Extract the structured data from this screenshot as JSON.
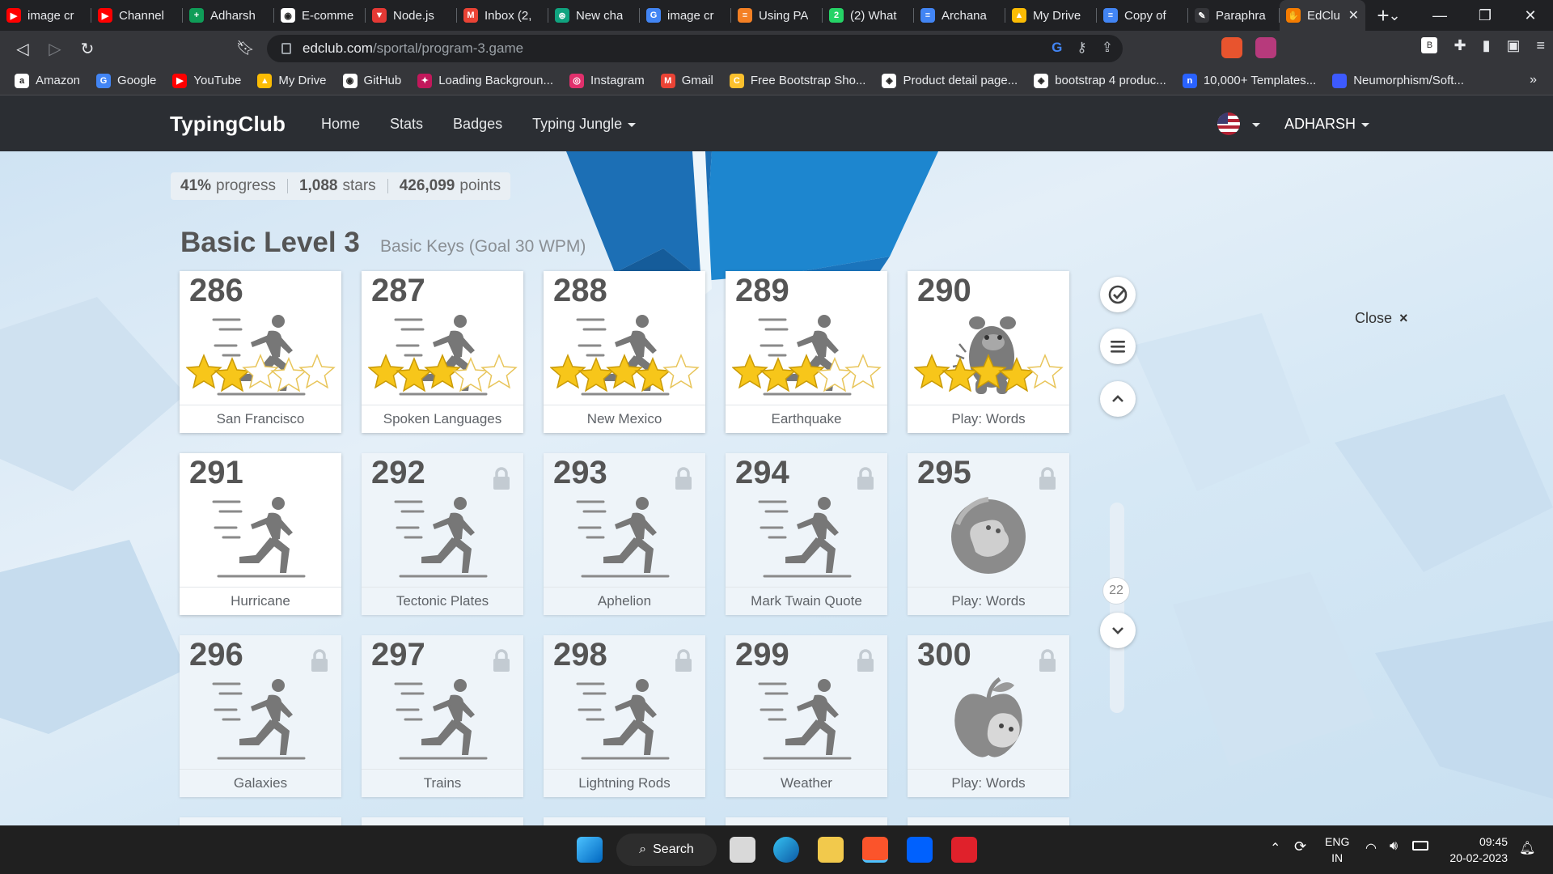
{
  "browser": {
    "tabs": [
      {
        "title": "image cr",
        "color": "#ff0000",
        "glyph": "▶"
      },
      {
        "title": "Channel",
        "color": "#ff0000",
        "glyph": "▶"
      },
      {
        "title": "Adharsh",
        "color": "#0f9d58",
        "glyph": "+"
      },
      {
        "title": "E-comme",
        "color": "#ffffff",
        "glyph": "◉"
      },
      {
        "title": "Node.js",
        "color": "#e53935",
        "glyph": "▼"
      },
      {
        "title": "Inbox (2,",
        "color": "#ea4335",
        "glyph": "M"
      },
      {
        "title": "New cha",
        "color": "#10a37f",
        "glyph": "⊛"
      },
      {
        "title": "image cr",
        "color": "#4285f4",
        "glyph": "G"
      },
      {
        "title": "Using PA",
        "color": "#f48024",
        "glyph": "≡"
      },
      {
        "title": "(2) What",
        "color": "#25d366",
        "glyph": "2"
      },
      {
        "title": "Archana",
        "color": "#4285f4",
        "glyph": "≡"
      },
      {
        "title": "My Drive",
        "color": "#fbbc04",
        "glyph": "▲"
      },
      {
        "title": "Copy of",
        "color": "#4285f4",
        "glyph": "≡"
      },
      {
        "title": "Paraphra",
        "color": "#35363a",
        "glyph": "✎"
      },
      {
        "title": "EdClu",
        "color": "#f57c00",
        "glyph": "✋"
      }
    ],
    "url_host": "edclub.com",
    "url_path": "/sportal/program-3.game",
    "bookmarks": [
      {
        "label": "Amazon",
        "color": "#ffffff",
        "glyph": "a"
      },
      {
        "label": "Google",
        "color": "#4285f4",
        "glyph": "G"
      },
      {
        "label": "YouTube",
        "color": "#ff0000",
        "glyph": "▶"
      },
      {
        "label": "My Drive",
        "color": "#fbbc04",
        "glyph": "▲"
      },
      {
        "label": "GitHub",
        "color": "#ffffff",
        "glyph": "◉"
      },
      {
        "label": "Loading Backgroun...",
        "color": "#c2185b",
        "glyph": "✦"
      },
      {
        "label": "Instagram",
        "color": "#e1306c",
        "glyph": "◎"
      },
      {
        "label": "Gmail",
        "color": "#ea4335",
        "glyph": "M"
      },
      {
        "label": "Free Bootstrap Sho...",
        "color": "#fbc02d",
        "glyph": "C"
      },
      {
        "label": "Product detail page...",
        "color": "#ffffff",
        "glyph": "◈"
      },
      {
        "label": "bootstrap 4 produc...",
        "color": "#ffffff",
        "glyph": "◈"
      },
      {
        "label": "10,000+ Templates...",
        "color": "#2962ff",
        "glyph": "n"
      },
      {
        "label": "Neumorphism/Soft...",
        "color": "#3d5afe",
        "glyph": ""
      }
    ],
    "bookmarks_more": "»"
  },
  "site": {
    "logo": "TypingClub",
    "nav": [
      "Home",
      "Stats",
      "Badges",
      "Typing Jungle"
    ],
    "user": "ADHARSH"
  },
  "progress": {
    "progress_value": "41%",
    "progress_label": "progress",
    "stars_value": "1,088",
    "stars_label": "stars",
    "points_value": "426,099",
    "points_label": "points"
  },
  "level": {
    "title": "Basic Level 3",
    "subtitle": "Basic Keys (Goal 30 WPM)"
  },
  "lessons": [
    {
      "num": "286",
      "name": "San Francisco",
      "type": "runner",
      "locked": false,
      "stars": 2
    },
    {
      "num": "287",
      "name": "Spoken Languages",
      "type": "runner",
      "locked": false,
      "stars": 3
    },
    {
      "num": "288",
      "name": "New Mexico",
      "type": "runner",
      "locked": false,
      "stars": 4
    },
    {
      "num": "289",
      "name": "Earthquake",
      "type": "runner",
      "locked": false,
      "stars": 3
    },
    {
      "num": "290",
      "name": "Play: Words",
      "type": "monster",
      "locked": false,
      "stars": 4
    },
    {
      "num": "291",
      "name": "Hurricane",
      "type": "runner",
      "locked": false,
      "stars": 0
    },
    {
      "num": "292",
      "name": "Tectonic Plates",
      "type": "runner",
      "locked": true,
      "stars": 0
    },
    {
      "num": "293",
      "name": "Aphelion",
      "type": "runner",
      "locked": true,
      "stars": 0
    },
    {
      "num": "294",
      "name": "Mark Twain Quote",
      "type": "runner",
      "locked": true,
      "stars": 0
    },
    {
      "num": "295",
      "name": "Play: Words",
      "type": "planet",
      "locked": true,
      "stars": 0
    },
    {
      "num": "296",
      "name": "Galaxies",
      "type": "runner",
      "locked": true,
      "stars": 0
    },
    {
      "num": "297",
      "name": "Trains",
      "type": "runner",
      "locked": true,
      "stars": 0
    },
    {
      "num": "298",
      "name": "Lightning Rods",
      "type": "runner",
      "locked": true,
      "stars": 0
    },
    {
      "num": "299",
      "name": "Weather",
      "type": "runner",
      "locked": true,
      "stars": 0
    },
    {
      "num": "300",
      "name": "Play: Words",
      "type": "apple",
      "locked": true,
      "stars": 0
    }
  ],
  "sidebar": {
    "close_label": "Close",
    "close_glyph": "×",
    "scroll_value": "22"
  },
  "taskbar": {
    "search_label": "Search",
    "lang_line1": "ENG",
    "lang_line2": "IN",
    "time": "09:45",
    "date": "20-02-2023"
  }
}
